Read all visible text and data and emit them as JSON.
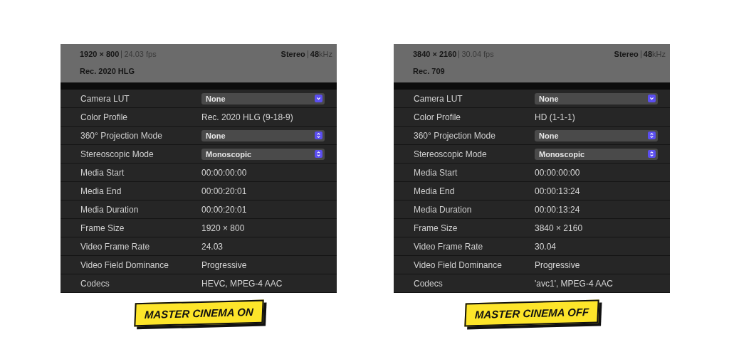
{
  "panels": [
    {
      "header": {
        "resolution": "1920 × 800",
        "frame_rate": "24.03 fps",
        "audio": "Stereo",
        "sample_rate": "**48**kHz",
        "color_space": "Rec. 2020 HLG"
      },
      "rows": [
        {
          "label": "Camera LUT",
          "kind": "pulldown",
          "value": "None"
        },
        {
          "label": "Color Profile",
          "kind": "text",
          "value": "Rec. 2020 HLG (9-18-9)"
        },
        {
          "label": "360° Projection Mode",
          "kind": "popup",
          "value": "None"
        },
        {
          "label": "Stereoscopic Mode",
          "kind": "popup",
          "value": "Monoscopic"
        },
        {
          "label": "Media Start",
          "kind": "text",
          "value": "00:00:00:00"
        },
        {
          "label": "Media End",
          "kind": "text",
          "value": "00:00:20:01"
        },
        {
          "label": "Media Duration",
          "kind": "text",
          "value": "00:00:20:01"
        },
        {
          "label": "Frame Size",
          "kind": "text",
          "value": "1920 × 800"
        },
        {
          "label": "Video Frame Rate",
          "kind": "text",
          "value": "24.03"
        },
        {
          "label": "Video Field Dominance",
          "kind": "text",
          "value": "Progressive"
        },
        {
          "label": "Codecs",
          "kind": "text",
          "value": "HEVC, MPEG-4 AAC"
        }
      ],
      "caption": "MASTER CINEMA ON"
    },
    {
      "header": {
        "resolution": "3840 × 2160",
        "frame_rate": "30.04 fps",
        "audio": "Stereo",
        "sample_rate": "**48**kHz",
        "color_space": "Rec. 709"
      },
      "rows": [
        {
          "label": "Camera LUT",
          "kind": "pulldown",
          "value": "None"
        },
        {
          "label": "Color Profile",
          "kind": "text",
          "value": "HD (1-1-1)"
        },
        {
          "label": "360° Projection Mode",
          "kind": "popup",
          "value": "None"
        },
        {
          "label": "Stereoscopic Mode",
          "kind": "popup",
          "value": "Monoscopic"
        },
        {
          "label": "Media Start",
          "kind": "text",
          "value": "00:00:00:00"
        },
        {
          "label": "Media End",
          "kind": "text",
          "value": "00:00:13:24"
        },
        {
          "label": "Media Duration",
          "kind": "text",
          "value": "00:00:13:24"
        },
        {
          "label": "Frame Size",
          "kind": "text",
          "value": "3840 × 2160"
        },
        {
          "label": "Video Frame Rate",
          "kind": "text",
          "value": "30.04"
        },
        {
          "label": "Video Field Dominance",
          "kind": "text",
          "value": "Progressive"
        },
        {
          "label": "Codecs",
          "kind": "text",
          "value": "'avc1', MPEG-4 AAC"
        }
      ],
      "caption": "MASTER CINEMA OFF"
    }
  ]
}
